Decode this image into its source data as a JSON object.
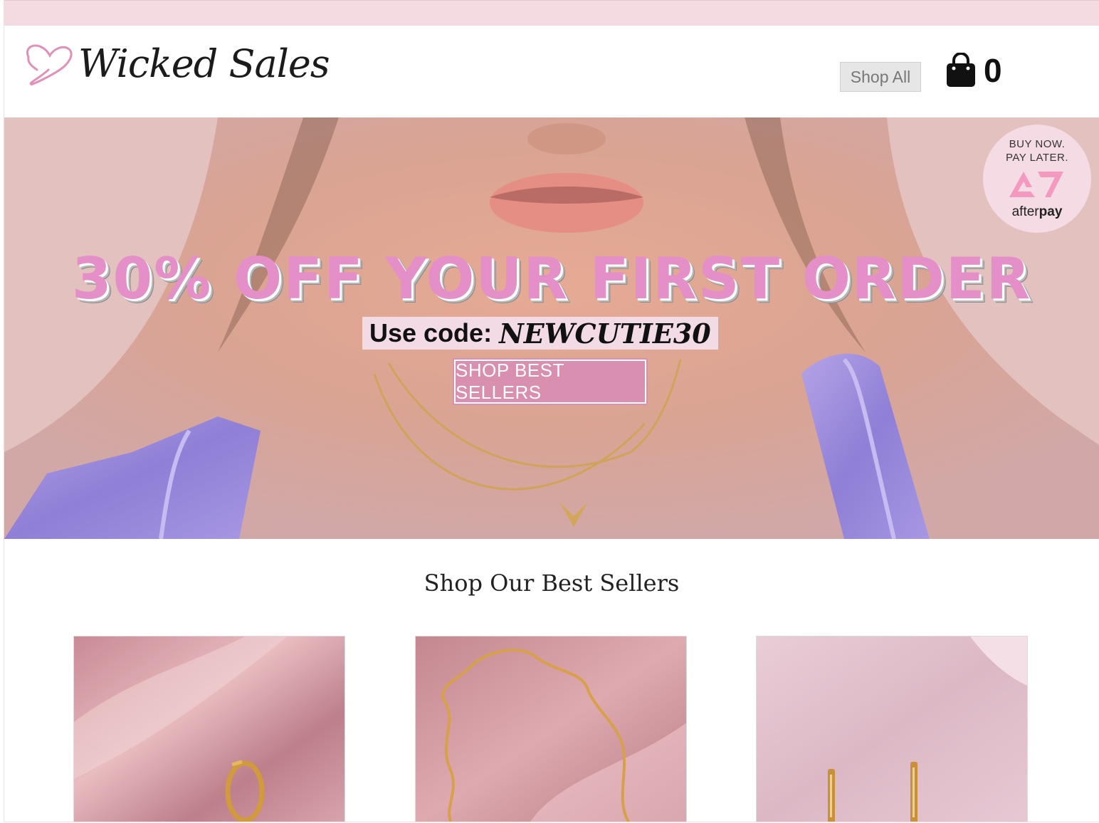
{
  "header": {
    "logo_text": "Wicked Sales",
    "shop_all_label": "Shop All",
    "cart_count": "0",
    "icons": {
      "logo": "heart-outline-icon",
      "cart": "shopping-bag-icon"
    }
  },
  "hero": {
    "promo_title": "30% OFF YOUR FIRST ORDER",
    "code_label": "Use code:",
    "code_value": "NEWCUTIE30",
    "cta_label": "SHOP BEST SELLERS",
    "afterpay": {
      "line1": "BUY NOW.",
      "line2": "PAY LATER.",
      "brand_light": "after",
      "brand_bold": "pay"
    }
  },
  "best_sellers": {
    "title": "Shop Our Best Sellers",
    "products": [
      {
        "image": "gold-huggie-earring-on-pink-satin"
      },
      {
        "image": "gold-chain-necklace-on-pink-satin"
      },
      {
        "image": "gold-bar-earrings-on-pink-satin"
      }
    ]
  },
  "colors": {
    "topbar": "#f3dbe1",
    "promo_pink": "#e48fc7",
    "button_pink": "#d88fb0",
    "code_box": "#f3dbe6"
  }
}
